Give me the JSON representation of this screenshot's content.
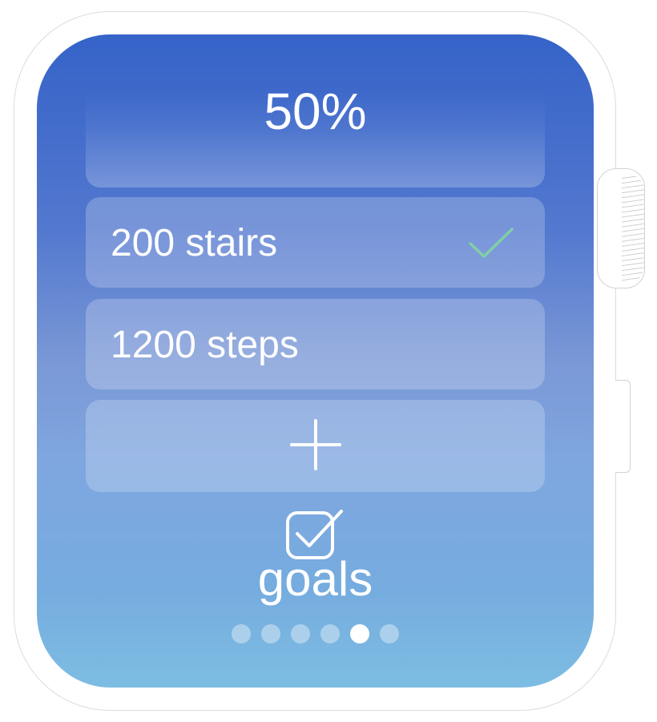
{
  "progress": {
    "percent_text": "50%"
  },
  "goals": {
    "items": [
      {
        "label": "200 stairs",
        "completed": true,
        "check_icon": "checkmark-icon",
        "check_color": "#7fd0a6"
      },
      {
        "label": "1200 steps",
        "completed": false
      }
    ],
    "add_icon": "plus-icon"
  },
  "page": {
    "icon": "checkbox-icon",
    "label": "goals"
  },
  "pager": {
    "total": 6,
    "active_index": 4
  },
  "colors": {
    "screen_top": "#3563c8",
    "screen_bottom": "#7dbde2",
    "text": "#ffffff"
  }
}
